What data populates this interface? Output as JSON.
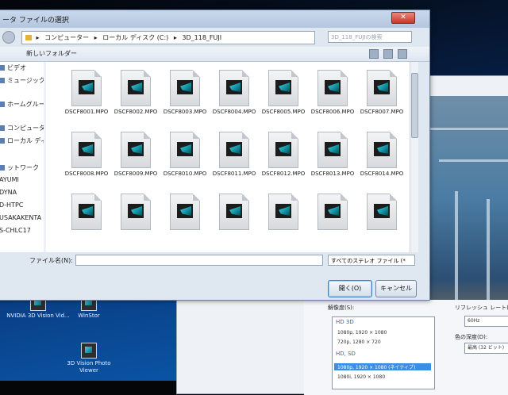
{
  "desktop": {
    "icons": [
      {
        "label": "NVIDIA 3D Vision Vid..."
      },
      {
        "label": "WinStor"
      },
      {
        "label": "3D Vision Photo Viewer"
      }
    ]
  },
  "dialog": {
    "title": "ータ ファイルの選択",
    "close_label": "✕",
    "address": {
      "parts": [
        "コンピューター",
        "ローカル ディスク (C:)",
        "3D_118_FUJI"
      ]
    },
    "search_placeholder": "3D_118_FUJIの検索",
    "toolbar": {
      "new_folder": "新しいフォルダー"
    },
    "nav_items": [
      {
        "label": "ビデオ",
        "icon": "video-icon"
      },
      {
        "label": "ミュージック",
        "icon": "music-icon"
      },
      {
        "label": "ホームグループ",
        "icon": "homegroup-icon"
      },
      {
        "label": "コンピューター",
        "icon": "computer-icon"
      },
      {
        "label": "ローカル ディス",
        "icon": "disk-icon"
      },
      {
        "label": "ットワーク",
        "icon": "network-icon"
      },
      {
        "label": "AYUMI",
        "icon": "pc-icon"
      },
      {
        "label": "DYNA",
        "icon": "pc-icon"
      },
      {
        "label": "D-HTPC",
        "icon": "pc-icon"
      },
      {
        "label": "USAKAKENTA",
        "icon": "pc-icon"
      },
      {
        "label": "S-CHLC17",
        "icon": "pc-icon"
      }
    ],
    "files": [
      "DSCF8001.MPO",
      "DSCF8002.MPO",
      "DSCF8003.MPO",
      "DSCF8004.MPO",
      "DSCF8005.MPO",
      "DSCF8006.MPO",
      "DSCF8007.MPO",
      "DSCF8008.MPO",
      "DSCF8009.MPO",
      "DSCF8010.MPO",
      "DSCF8011.MPO",
      "DSCF8012.MPO",
      "DSCF8013.MPO",
      "DSCF8014.MPO",
      "",
      "",
      "",
      "",
      "",
      "",
      ""
    ],
    "filename_label": "ファイル名(N):",
    "filename_value": "",
    "filetype_value": "すべてのステレオ ファイル (*",
    "open_label": "開く(O)",
    "cancel_label": "キャンセル"
  },
  "settings": {
    "resolution_label": "解像度(S):",
    "refresh_label": "リフレッシュ レート(R)",
    "refresh_value": "60Hz",
    "color_label": "色の深度(D):",
    "color_value": "最高 (32 ビット)",
    "resolutions": [
      {
        "group": "HD 3D"
      },
      {
        "item": "1080p, 1920 × 1080"
      },
      {
        "item": "720p, 1280 × 720"
      },
      {
        "group": "HD, SD"
      },
      {
        "item": "1080p, 1920 × 1080 (ネイティブ)",
        "selected": true
      },
      {
        "item": "1080i, 1920 × 1080"
      }
    ]
  },
  "colors": {
    "accent": "#3a8ee6",
    "desktop": "#0a4a9a"
  }
}
